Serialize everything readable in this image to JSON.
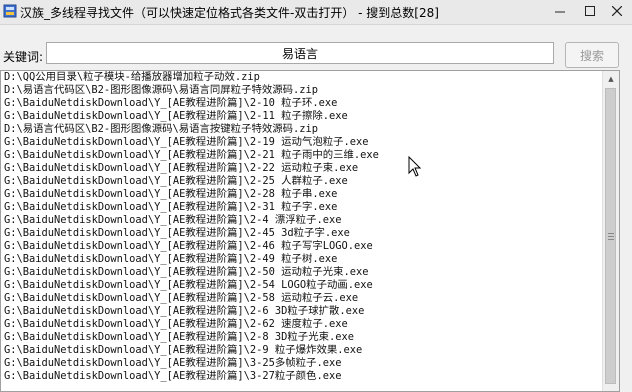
{
  "window": {
    "title": "汉族_多线程寻找文件（可以快速定位格式各类文件-双击打开） - 搜到总数[28]",
    "minimize_icon": "minimize-icon",
    "maximize_icon": "maximize-icon",
    "close_icon": "close-icon"
  },
  "search": {
    "label": "关键词:",
    "value": "易语言",
    "button_label": "搜索"
  },
  "results": [
    "D:\\QQ公用目录\\粒子模块-给播放器增加粒子动效.zip",
    "D:\\易语言代码区\\B2-图形图像源码\\易语言同屏粒子特效源码.zip",
    "G:\\BaiduNetdiskDownload\\Y_[AE教程进阶篇]\\2-10 粒子环.exe",
    "G:\\BaiduNetdiskDownload\\Y_[AE教程进阶篇]\\2-11 粒子擦除.exe",
    "D:\\易语言代码区\\B2-图形图像源码\\易语言按键粒子特效源码.zip",
    "G:\\BaiduNetdiskDownload\\Y_[AE教程进阶篇]\\2-19 运动气泡粒子.exe",
    "G:\\BaiduNetdiskDownload\\Y_[AE教程进阶篇]\\2-21 粒子雨中的三维.exe",
    "G:\\BaiduNetdiskDownload\\Y_[AE教程进阶篇]\\2-22 运动粒子束.exe",
    "G:\\BaiduNetdiskDownload\\Y_[AE教程进阶篇]\\2-25 人群粒子.exe",
    "G:\\BaiduNetdiskDownload\\Y_[AE教程进阶篇]\\2-28 粒子串.exe",
    "G:\\BaiduNetdiskDownload\\Y_[AE教程进阶篇]\\2-31 粒子字.exe",
    "G:\\BaiduNetdiskDownload\\Y_[AE教程进阶篇]\\2-4 漂浮粒子.exe",
    "G:\\BaiduNetdiskDownload\\Y_[AE教程进阶篇]\\2-45 3d粒子字.exe",
    "G:\\BaiduNetdiskDownload\\Y_[AE教程进阶篇]\\2-46 粒子写字LOGO.exe",
    "G:\\BaiduNetdiskDownload\\Y_[AE教程进阶篇]\\2-49 粒子树.exe",
    "G:\\BaiduNetdiskDownload\\Y_[AE教程进阶篇]\\2-50 运动粒子光束.exe",
    "G:\\BaiduNetdiskDownload\\Y_[AE教程进阶篇]\\2-54 LOGO粒子动画.exe",
    "G:\\BaiduNetdiskDownload\\Y_[AE教程进阶篇]\\2-58 运动粒子云.exe",
    "G:\\BaiduNetdiskDownload\\Y_[AE教程进阶篇]\\2-6 3D粒子球扩散.exe",
    "G:\\BaiduNetdiskDownload\\Y_[AE教程进阶篇]\\2-62 速度粒子.exe",
    "G:\\BaiduNetdiskDownload\\Y_[AE教程进阶篇]\\2-8 3D粒子光束.exe",
    "G:\\BaiduNetdiskDownload\\Y_[AE教程进阶篇]\\2-9 粒子爆炸效果.exe",
    "G:\\BaiduNetdiskDownload\\Y_[AE教程进阶篇]\\3-25多帧粒子.exe",
    "G:\\BaiduNetdiskDownload\\Y_[AE教程进阶篇]\\3-27粒子颜色.exe"
  ]
}
